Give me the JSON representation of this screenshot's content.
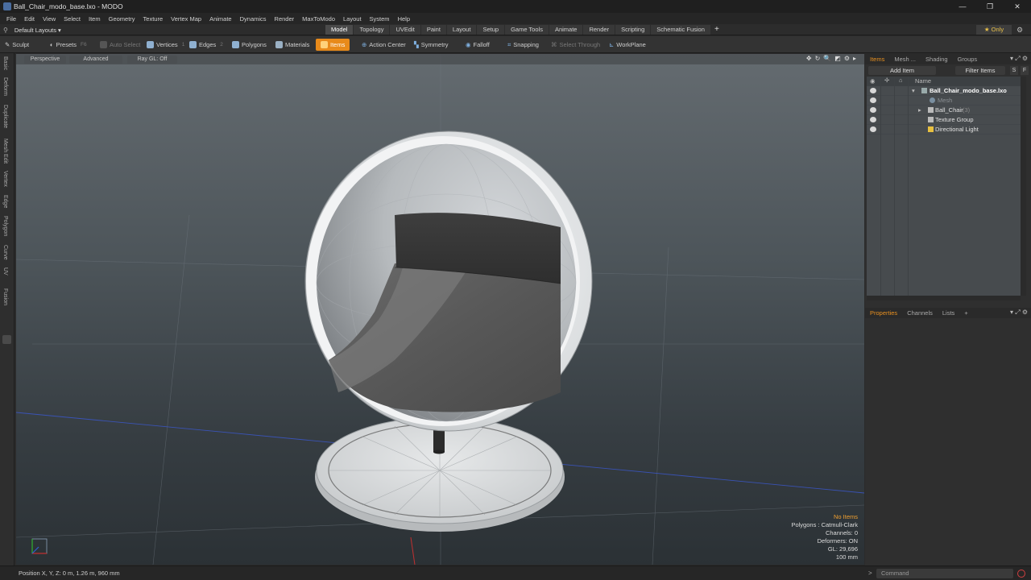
{
  "window": {
    "title": "Ball_Chair_modo_base.lxo - MODO",
    "controls": [
      "—",
      "❐",
      "✕"
    ]
  },
  "menu": [
    "File",
    "Edit",
    "View",
    "Select",
    "Item",
    "Geometry",
    "Texture",
    "Vertex Map",
    "Animate",
    "Dynamics",
    "Render",
    "MaxToModo",
    "Layout",
    "System",
    "Help"
  ],
  "layout_bar": {
    "layouts_label": "Default Layouts ▾",
    "tabs": [
      "Model",
      "Topology",
      "UVEdit",
      "Paint",
      "Layout",
      "Setup",
      "Game Tools",
      "Animate",
      "Render",
      "Scripting",
      "Schematic Fusion"
    ],
    "active_tab": "Model",
    "add_tab": "+",
    "only_label": "★ Only",
    "accent": "#e88a1a"
  },
  "toolbar": {
    "sculpt": "Sculpt",
    "presets": "Presets",
    "presets_key": "F6",
    "auto_select": "Auto Select",
    "vertices": "Vertices",
    "vertices_key": "1",
    "edges": "Edges",
    "edges_key": "2",
    "polygons": "Polygons",
    "materials": "Materials",
    "items": "Items",
    "action_center": "Action Center",
    "symmetry": "Symmetry",
    "falloff": "Falloff",
    "snapping": "Snapping",
    "select_through": "Select Through",
    "workplane": "WorkPlane"
  },
  "left_tabs": [
    "Basic",
    "Deform",
    "Duplicate",
    "Mesh Edit",
    "Vertex",
    "Edge",
    "Polygon",
    "Curve",
    "UV",
    "Fusion"
  ],
  "viewport": {
    "view_mode": "Perspective",
    "shading": "Advanced",
    "ray_gl": "Ray GL: Off",
    "tools": [
      "✥",
      "↻",
      "🔍",
      "◩",
      "⚙",
      "▸"
    ],
    "hud": {
      "selection": "No Items",
      "polygons": "Polygons : Catmull-Clark",
      "channels": "Channels: 0",
      "deformers": "Deformers: ON",
      "gl": "GL: 29,696",
      "grid": "100 mm"
    }
  },
  "items_panel": {
    "tabs": [
      "Items",
      "Mesh ...",
      "Shading",
      "Groups"
    ],
    "active_tab": "Items",
    "add_item": "Add Item",
    "filter_items": "Filter Items",
    "s_btn": "S",
    "f_btn": "F",
    "name_header": "Name",
    "tree": [
      {
        "label": "Ball_Chair_modo_base.lxo",
        "bold": true
      },
      {
        "label": "Mesh",
        "dim": true
      },
      {
        "label": "Ball_Chair",
        "suffix": "(3)"
      },
      {
        "label": "Texture Group"
      },
      {
        "label": "Directional Light"
      }
    ]
  },
  "properties_panel": {
    "tabs": [
      "Properties",
      "Channels",
      "Lists"
    ],
    "active_tab": "Properties",
    "add": "+"
  },
  "statusbar": {
    "position": "Position X, Y, Z:   0 m, 1.26 m, 960 mm",
    "command_placeholder": "Command"
  }
}
